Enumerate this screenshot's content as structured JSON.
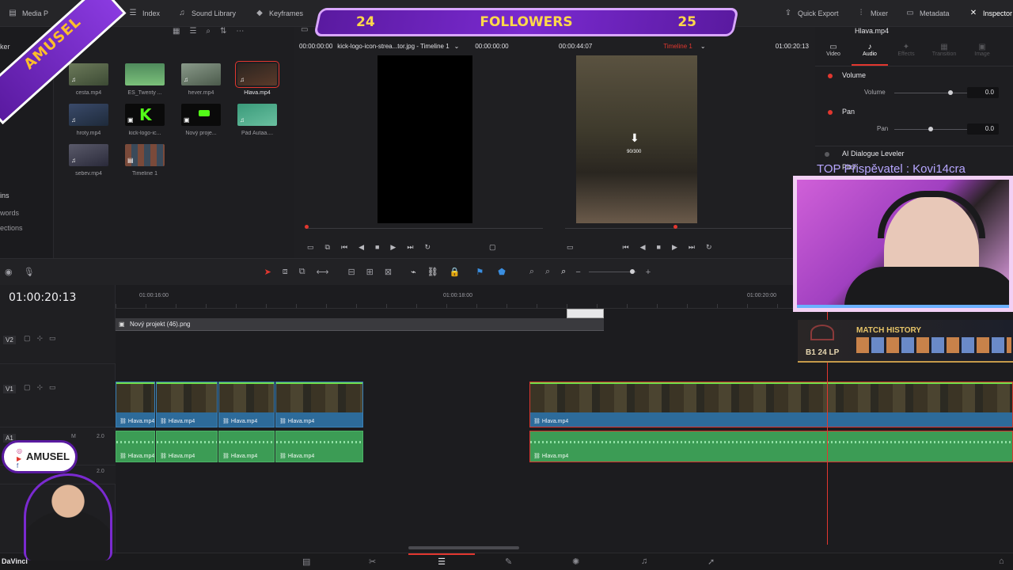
{
  "topbar": {
    "media_pool": "Media P",
    "index": "Index",
    "sound_library": "Sound Library",
    "keyframes": "Keyframes",
    "quick_export": "Quick Export",
    "mixer": "Mixer",
    "metadata": "Metadata",
    "inspector": "Inspector"
  },
  "left_sidebar": {
    "trailing_text": "ker",
    "bins": "ins",
    "keywords": "words",
    "collections": "ections"
  },
  "media_pool": {
    "clips": [
      {
        "name": "cesta.mp4",
        "type": "video"
      },
      {
        "name": "ES_Twenty ...",
        "type": "video"
      },
      {
        "name": "hever.mp4",
        "type": "video"
      },
      {
        "name": "Hlava.mp4",
        "type": "video",
        "selected": true
      },
      {
        "name": "hroty.mp4",
        "type": "video"
      },
      {
        "name": "kick-logo-ic...",
        "type": "image"
      },
      {
        "name": "Nový proje...",
        "type": "image"
      },
      {
        "name": "Pád Autaa....",
        "type": "video"
      },
      {
        "name": "sebev.mp4",
        "type": "video"
      },
      {
        "name": "Timeline 1",
        "type": "timeline"
      }
    ]
  },
  "source_viewer": {
    "timecode_in": "00:00:00:00",
    "clip_name": "kick-logo-icon-strea...tor.jpg - Timeline 1",
    "timecode_dur": "00:00:00:00"
  },
  "timeline_viewer": {
    "duration": "00:00:44:07",
    "timeline_name": "Timeline 1",
    "timecode": "01:00:20:13",
    "download_progress": "90/300"
  },
  "inspector": {
    "clip_title": "Hlava.mp4",
    "tabs": [
      "Video",
      "Audio",
      "Effects",
      "Transition",
      "Image"
    ],
    "active_tab": "Audio",
    "volume_label": "Volume",
    "volume_param": "Volume",
    "volume_value": "0.0",
    "pan_label": "Pan",
    "pan_param": "Pan",
    "pan_value": "0.0",
    "ai_label": "AI Dialogue Leveler",
    "pitch_label": "Pitch"
  },
  "timeline": {
    "current_timecode": "01:00:20:13",
    "ruler": [
      "01:00:16:00",
      "01:00:18:00",
      "01:00:20:00"
    ],
    "tracks": [
      {
        "id": "V2"
      },
      {
        "id": "V1"
      },
      {
        "id": "A1",
        "level": "2.0",
        "mode": "M"
      },
      {
        "id": "A2",
        "level": "2.0"
      }
    ],
    "v2_clip": "Nový projekt (46).png",
    "clip_name": "Hlava.mp4"
  },
  "overlays": {
    "followers_current": "24",
    "followers_label": "FOLLOWERS",
    "followers_goal": "25",
    "brand": "AMUSEL",
    "brand_small": "AMUSEL",
    "top_donor": "TOP Přispěvatel : Kovi14cra",
    "match_history": "MATCH HISTORY",
    "rank": "B1 24 LP",
    "app": "DaVinci"
  },
  "colors": {
    "accent_red": "#e2372f",
    "clip_blue": "#2d6b9a",
    "clip_green": "#3c9c55",
    "overlay_purple": "#7a2ad0"
  }
}
